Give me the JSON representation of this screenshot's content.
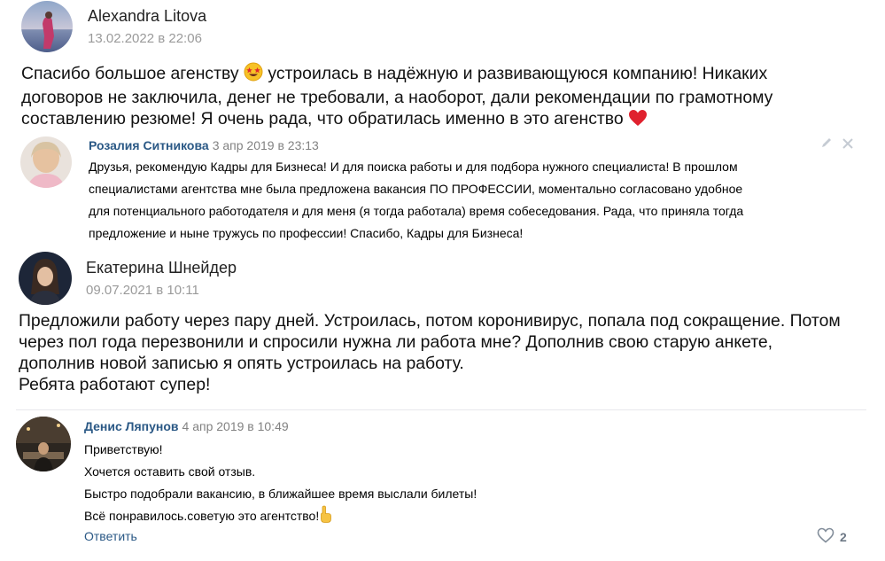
{
  "review1": {
    "author": "Alexandra Litova",
    "date": "13.02.2022 в 22:06",
    "text_before_emoji": "Спасибо большое агенству ",
    "text_after_emoji": " устроилась в надёжную и развивающуюся компанию! Никаких\nдоговоров не заключила, денег не требовали, а наоборот, дали рекомендации по грамотному\nсоставлению резюме! Я очень рада, что обратилась именно в это агенство "
  },
  "comment1": {
    "author": "Розалия Ситникова",
    "date": "3 апр 2019 в 23:13",
    "text": "Друзья, рекомендую Кадры для Бизнеса! И для поиска работы и для подбора нужного специалиста! В прошлом\nспециалистами агентства мне была предложена вакансия ПО ПРОФЕССИИ, моментально согласовано удобное\nдля потенциального работодателя и для меня (я тогда работала) время собеседования. Рада, что приняла тогда\nпредложение и ныне тружусь по профессии! Спасибо, Кадры для Бизнеса!"
  },
  "review2": {
    "author": "Екатерина Шнейдер",
    "date": "09.07.2021 в 10:11",
    "text": "Предложили работу через пару дней. Устроилась, потом коронивирус, попала под сокращение. Потом\nчерез пол года перезвонили и спросили нужна ли работа мне? Дополнив свою старую анкете,\nдополнив новой записью я опять устроилась на работу.\nРебята работают супер!"
  },
  "comment2": {
    "author": "Денис Ляпунов",
    "date": "4 апр 2019 в 10:49",
    "text": "Приветствую!\nХочется оставить свой отзыв.\nБыстро подобрали вакансию, в ближайшее время выслали билеты!\nВсё понравилось.советую это агентство!",
    "reply_label": "Ответить",
    "likes": "2"
  },
  "icons": {
    "emoji_star_eyes": "star-struck-emoji",
    "emoji_heart": "red-heart-emoji",
    "emoji_finger": "pointing-finger-emoji",
    "edit": "pencil-icon",
    "close": "close-icon",
    "like": "heart-outline-icon"
  },
  "colors": {
    "link": "#2a5885",
    "muted": "#828282",
    "date": "#9a9a9a"
  }
}
